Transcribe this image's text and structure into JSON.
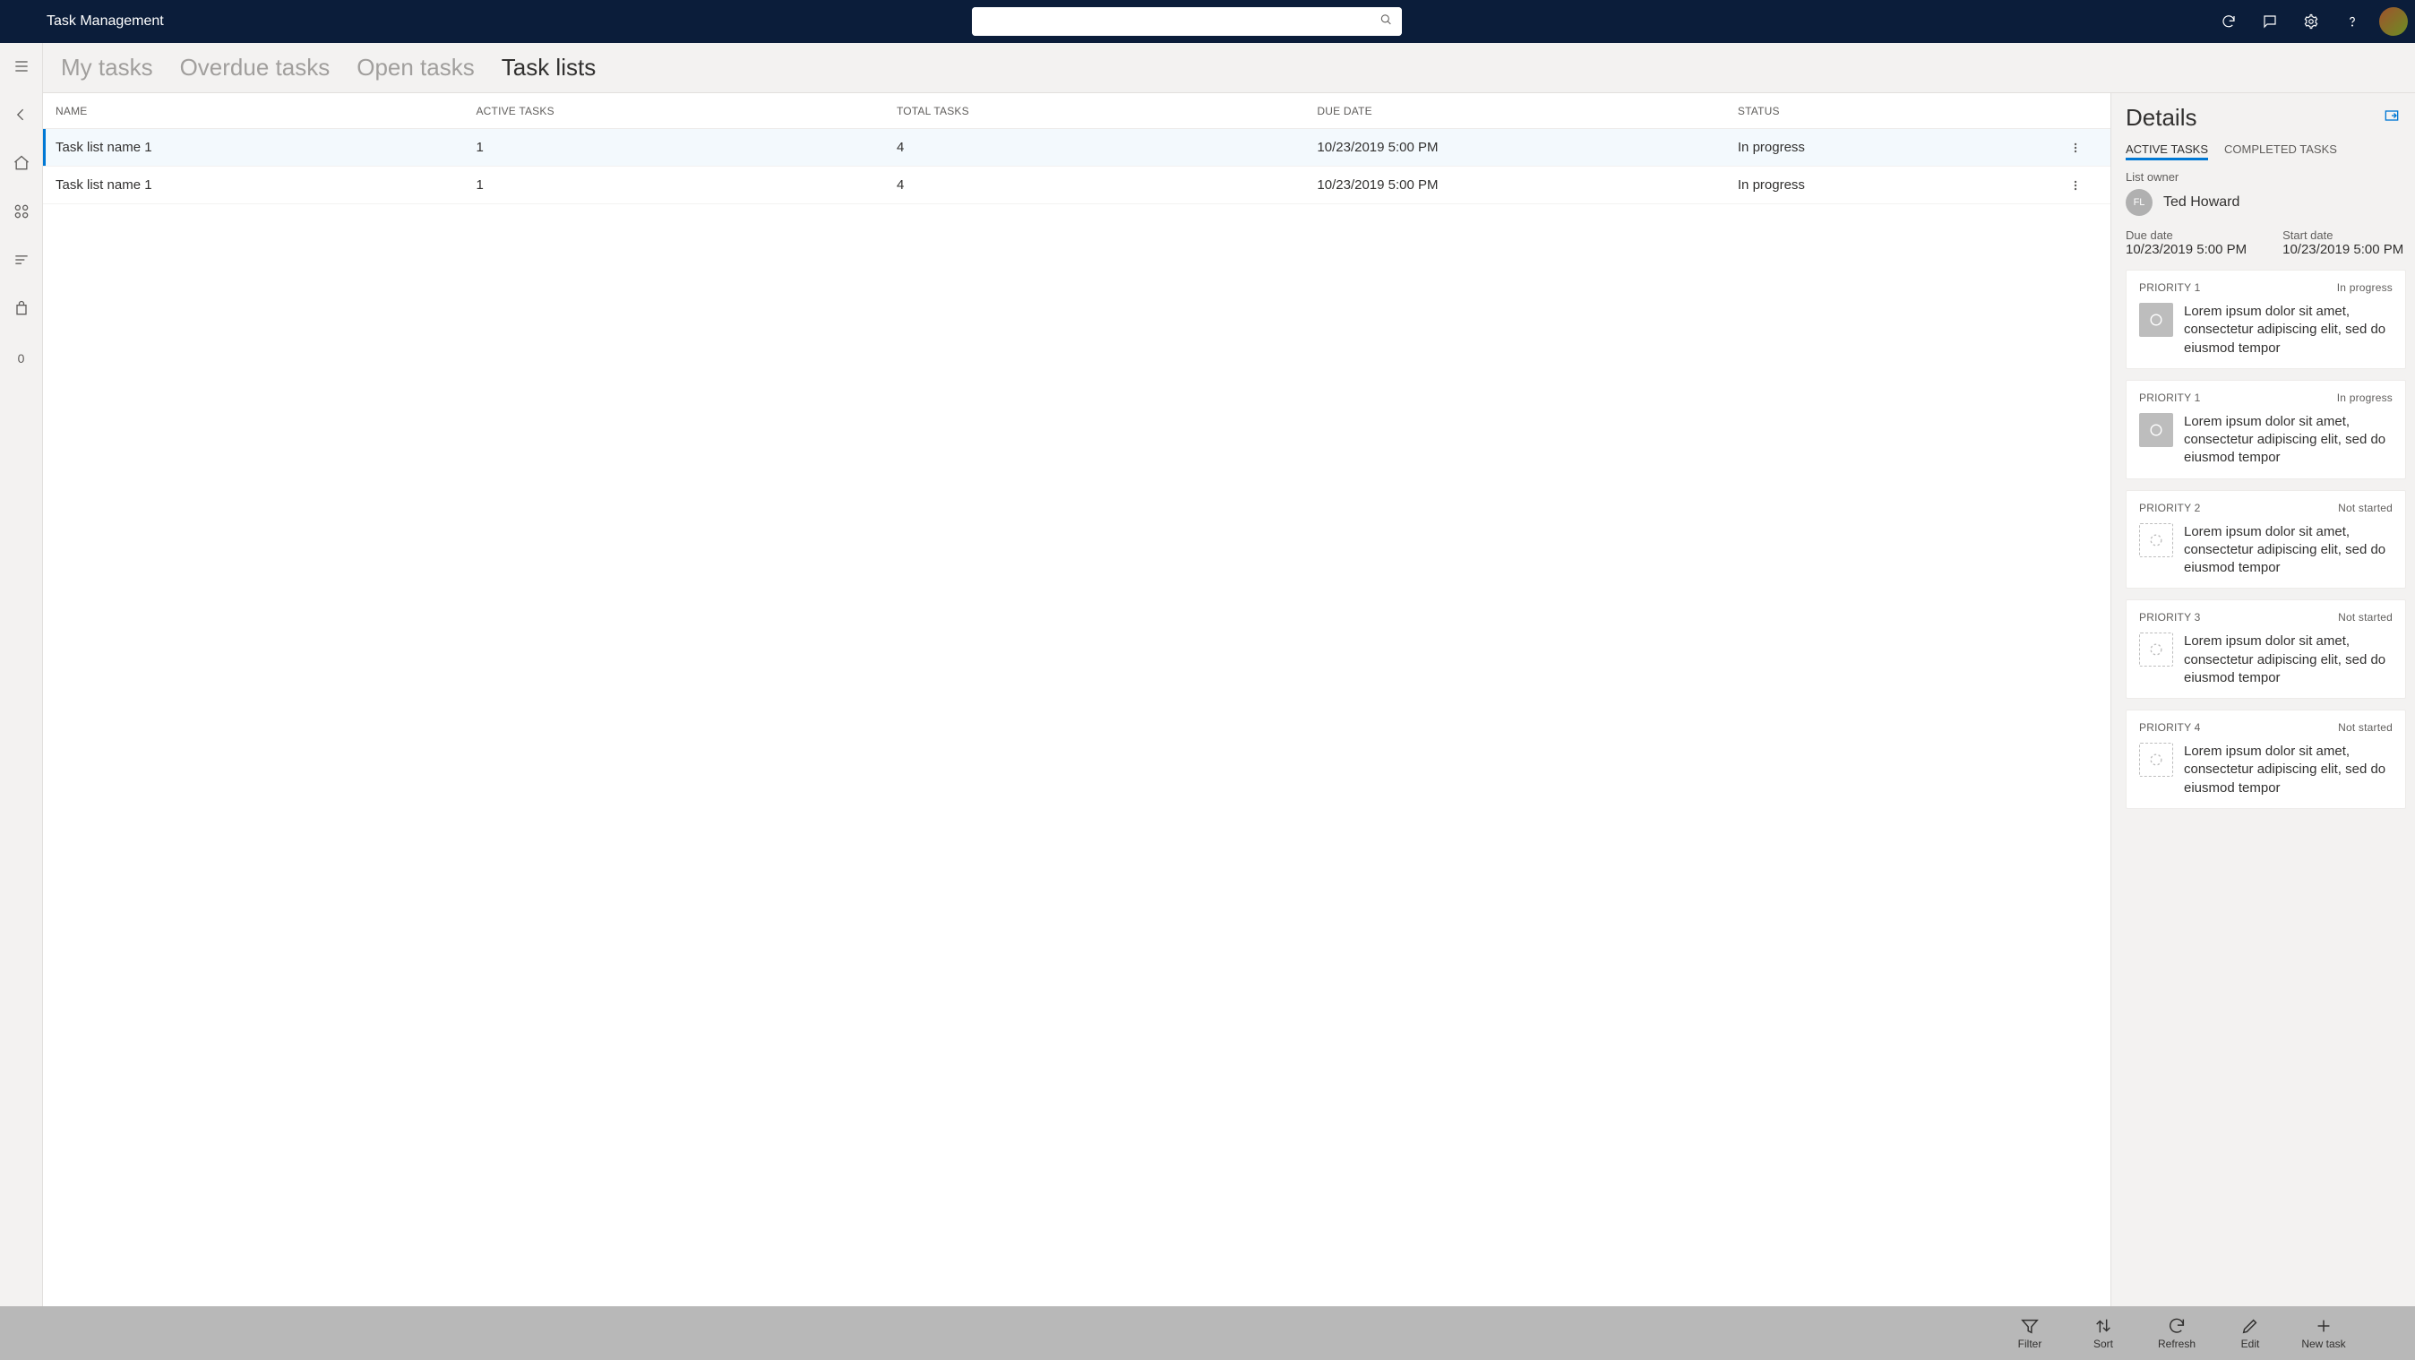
{
  "app_title": "Task Management",
  "search": {
    "placeholder": ""
  },
  "tabs": {
    "my_tasks": "My tasks",
    "overdue": "Overdue tasks",
    "open": "Open tasks",
    "task_lists": "Task lists"
  },
  "columns": {
    "name": "NAME",
    "active": "ACTIVE TASKS",
    "total": "TOTAL TASKS",
    "due": "DUE DATE",
    "status": "STATUS"
  },
  "rows": [
    {
      "name": "Task list name 1",
      "active": "1",
      "total": "4",
      "due": "10/23/2019 5:00 PM",
      "status": "In progress"
    },
    {
      "name": "Task list name 1",
      "active": "1",
      "total": "4",
      "due": "10/23/2019 5:00 PM",
      "status": "In progress"
    }
  ],
  "details": {
    "title": "Details",
    "tabs": {
      "active": "ACTIVE TASKS",
      "completed": "COMPLETED TASKS"
    },
    "owner_label": "List owner",
    "owner_initials": "FL",
    "owner_name": "Ted Howard",
    "due_label": "Due date",
    "due_value": "10/23/2019 5:00 PM",
    "start_label": "Start date",
    "start_value": "10/23/2019 5:00 PM",
    "cards": [
      {
        "priority": "PRIORITY 1",
        "status": "In progress",
        "desc": "Lorem ipsum dolor sit amet, consectetur adipiscing elit, sed do eiusmod tempor",
        "iconStyle": "solid"
      },
      {
        "priority": "PRIORITY 1",
        "status": "In progress",
        "desc": "Lorem ipsum dolor sit amet, consectetur adipiscing elit, sed do eiusmod tempor",
        "iconStyle": "solid"
      },
      {
        "priority": "PRIORITY 2",
        "status": "Not started",
        "desc": "Lorem ipsum dolor sit amet, consectetur adipiscing elit, sed do eiusmod tempor",
        "iconStyle": "dashed"
      },
      {
        "priority": "PRIORITY 3",
        "status": "Not started",
        "desc": "Lorem ipsum dolor sit amet, consectetur adipiscing elit, sed do eiusmod tempor",
        "iconStyle": "dashed"
      },
      {
        "priority": "PRIORITY 4",
        "status": "Not started",
        "desc": "Lorem ipsum dolor sit amet, consectetur adipiscing elit, sed do eiusmod tempor",
        "iconStyle": "dashed"
      }
    ]
  },
  "cmd": {
    "filter": "Filter",
    "sort": "Sort",
    "refresh": "Refresh",
    "edit": "Edit",
    "new": "New task"
  },
  "rail_badge": "0"
}
